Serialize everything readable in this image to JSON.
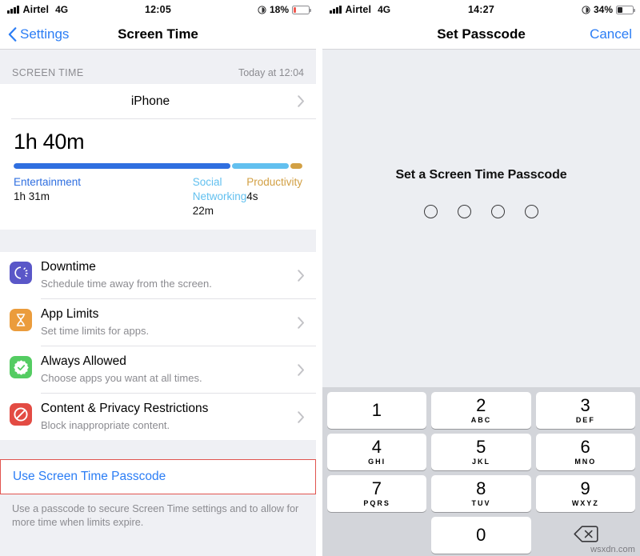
{
  "left": {
    "status": {
      "carrier": "Airtel",
      "network": "4G",
      "time": "12:05",
      "battery_pct": "18%",
      "battery_level": 18,
      "battery_color": "#f05a52"
    },
    "nav": {
      "back_label": "Settings",
      "title": "Screen Time"
    },
    "section_header": {
      "label": "SCREEN TIME",
      "right": "Today at 12:04"
    },
    "device_row": {
      "label": "iPhone"
    },
    "usage": {
      "total": "1h 40m",
      "categories": [
        {
          "name": "Entertainment",
          "value": "1h 31m",
          "color": "#2f6fe0",
          "pct": 73
        },
        {
          "name": "Social Networking",
          "value": "22m",
          "color": "#62c0ef",
          "pct": 19
        },
        {
          "name": "Productivity",
          "value": "4s",
          "color": "#d2a044",
          "pct": 4
        }
      ]
    },
    "items": [
      {
        "title": "Downtime",
        "sub": "Schedule time away from the screen.",
        "icon": "downtime-icon",
        "color": "#5a57c8"
      },
      {
        "title": "App Limits",
        "sub": "Set time limits for apps.",
        "icon": "hourglass-icon",
        "color": "#eb9c3c"
      },
      {
        "title": "Always Allowed",
        "sub": "Choose apps you want at all times.",
        "icon": "checkmark-badge-icon",
        "color": "#54cc62"
      },
      {
        "title": "Content & Privacy Restrictions",
        "sub": "Block inappropriate content.",
        "icon": "no-entry-icon",
        "color": "#e34b43"
      }
    ],
    "passcode": {
      "link_label": "Use Screen Time Passcode",
      "footnote": "Use a passcode to secure Screen Time settings and to allow for more time when limits expire.",
      "highlight_color": "#e1544f"
    }
  },
  "right": {
    "status": {
      "carrier": "Airtel",
      "network": "4G",
      "time": "14:27",
      "battery_pct": "34%",
      "battery_level": 34,
      "battery_color": "#232326"
    },
    "nav": {
      "title": "Set Passcode",
      "cancel_label": "Cancel"
    },
    "prompt": "Set a Screen Time Passcode",
    "dots": 4,
    "keypad": [
      [
        {
          "num": "1",
          "sub": ""
        },
        {
          "num": "2",
          "sub": "ABC"
        },
        {
          "num": "3",
          "sub": "DEF"
        }
      ],
      [
        {
          "num": "4",
          "sub": "GHI"
        },
        {
          "num": "5",
          "sub": "JKL"
        },
        {
          "num": "6",
          "sub": "MNO"
        }
      ],
      [
        {
          "num": "7",
          "sub": "PQRS"
        },
        {
          "num": "8",
          "sub": "TUV"
        },
        {
          "num": "9",
          "sub": "WXYZ"
        }
      ],
      [
        {
          "num": "",
          "sub": "",
          "blank": true
        },
        {
          "num": "0",
          "sub": ""
        },
        {
          "num": "",
          "sub": "",
          "delete": true
        }
      ]
    ],
    "watermark": "wsxdn.com"
  },
  "accent": "#2b7df5"
}
